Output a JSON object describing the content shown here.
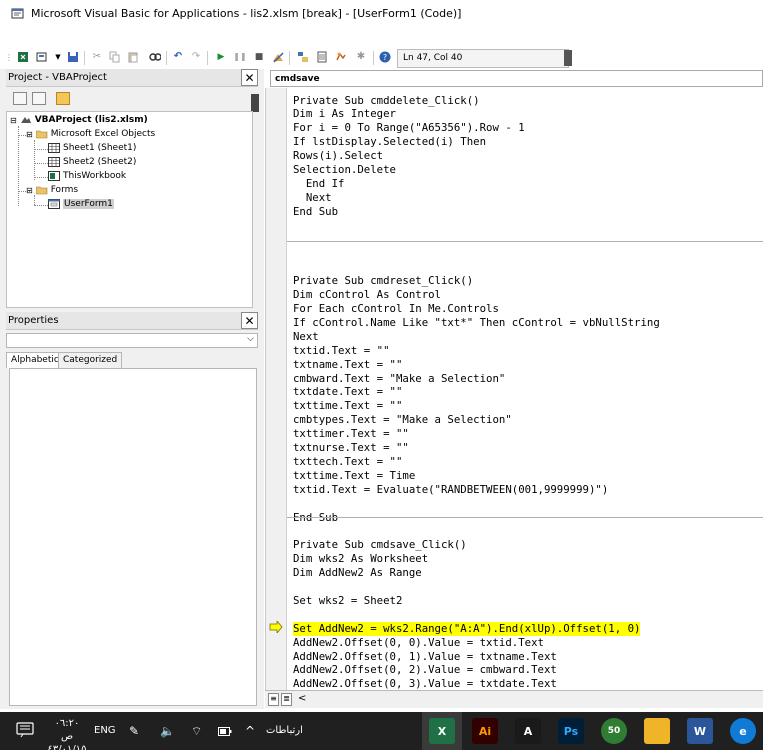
{
  "window": {
    "title": "Microsoft Visual Basic for Applications - lis2.xlsm [break] - [UserForm1 (Code)]"
  },
  "toolbar": {
    "icons": [
      "excel-icon",
      "insert-userform-icon",
      "save-icon",
      "cut-icon",
      "copy-icon",
      "paste-icon",
      "find-icon",
      "undo-icon",
      "redo-icon",
      "run-icon",
      "break-icon",
      "reset-icon",
      "design-mode-icon",
      "project-explorer-icon",
      "properties-icon",
      "object-browser-icon",
      "toolbox-icon",
      "help-icon"
    ],
    "position": "Ln 47, Col 40"
  },
  "project": {
    "title": "Project - VBAProject",
    "close_label": "✕",
    "tree": {
      "root": "VBAProject (lis2.xlsm)",
      "excel_objects_folder": "Microsoft Excel Objects",
      "sheet1": "Sheet1 (Sheet1)",
      "sheet2": "Sheet2 (Sheet2)",
      "workbook": "ThisWorkbook",
      "forms_folder": "Forms",
      "userform": "UserForm1"
    }
  },
  "properties": {
    "title": "Properties",
    "close_label": "✕",
    "tab_alphabetic": "Alphabetic",
    "tab_categorized": "Categorized"
  },
  "editor": {
    "object_combo": "cmdsave",
    "lines": [
      "Private Sub cmddelete_Click()",
      "Dim i As Integer",
      "For i = 0 To Range(\"A65356\").Row - 1",
      "If lstDisplay.Selected(i) Then",
      "Rows(i).Select",
      "Selection.Delete",
      "  End If",
      "  Next",
      "End Sub",
      "",
      "",
      "",
      "",
      "Private Sub cmdreset_Click()",
      "Dim cControl As Control",
      "For Each cControl In Me.Controls",
      "If cControl.Name Like \"txt*\" Then cControl = vbNullString",
      "Next",
      "txtid.Text = \"\"",
      "txtname.Text = \"\"",
      "cmbward.Text = \"Make a Selection\"",
      "txtdate.Text = \"\"",
      "txttime.Text = \"\"",
      "cmbtypes.Text = \"Make a Selection\"",
      "txttimer.Text = \"\"",
      "txtnurse.Text = \"\"",
      "txttech.Text = \"\"",
      "txttime.Text = Time",
      "txtid.Text = Evaluate(\"RANDBETWEEN(001,9999999)\")",
      "",
      "End Sub",
      "",
      "Private Sub cmdsave_Click()",
      "Dim wks2 As Worksheet",
      "Dim AddNew2 As Range",
      "",
      "Set wks2 = Sheet2",
      "",
      "Set AddNew2 = wks2.Range(\"A:A\").End(xlUp).Offset(1, 0)",
      "AddNew2.Offset(0, 0).Value = txtid.Text",
      "AddNew2.Offset(0, 1).Value = txtname.Text",
      "AddNew2.Offset(0, 2).Value = cmbward.Text",
      "AddNew2.Offset(0, 3).Value = txtdate.Text"
    ],
    "highlight_color": "#ffff00"
  },
  "taskbar": {
    "time": "٠٦:٢٠ ص",
    "date": "٤٣/٠١/١٥",
    "language": "ENG",
    "connections_label": "ارتباطات",
    "apps": [
      {
        "name": "Excel",
        "label": "X",
        "color": "#1f7145"
      },
      {
        "name": "Illustrator",
        "label": "Ai",
        "color": "#330000"
      },
      {
        "name": "Acrobat",
        "label": "A",
        "color": "#1a1a1a"
      },
      {
        "name": "Photoshop",
        "label": "Ps",
        "color": "#001e36"
      },
      {
        "name": "Notification app",
        "label": "50",
        "color": "#2e7d32"
      },
      {
        "name": "File Explorer",
        "label": "",
        "color": "#f0b429"
      },
      {
        "name": "Word",
        "label": "W",
        "color": "#2b579a"
      },
      {
        "name": "Edge",
        "label": "e",
        "color": "#0f7bd6"
      }
    ]
  }
}
